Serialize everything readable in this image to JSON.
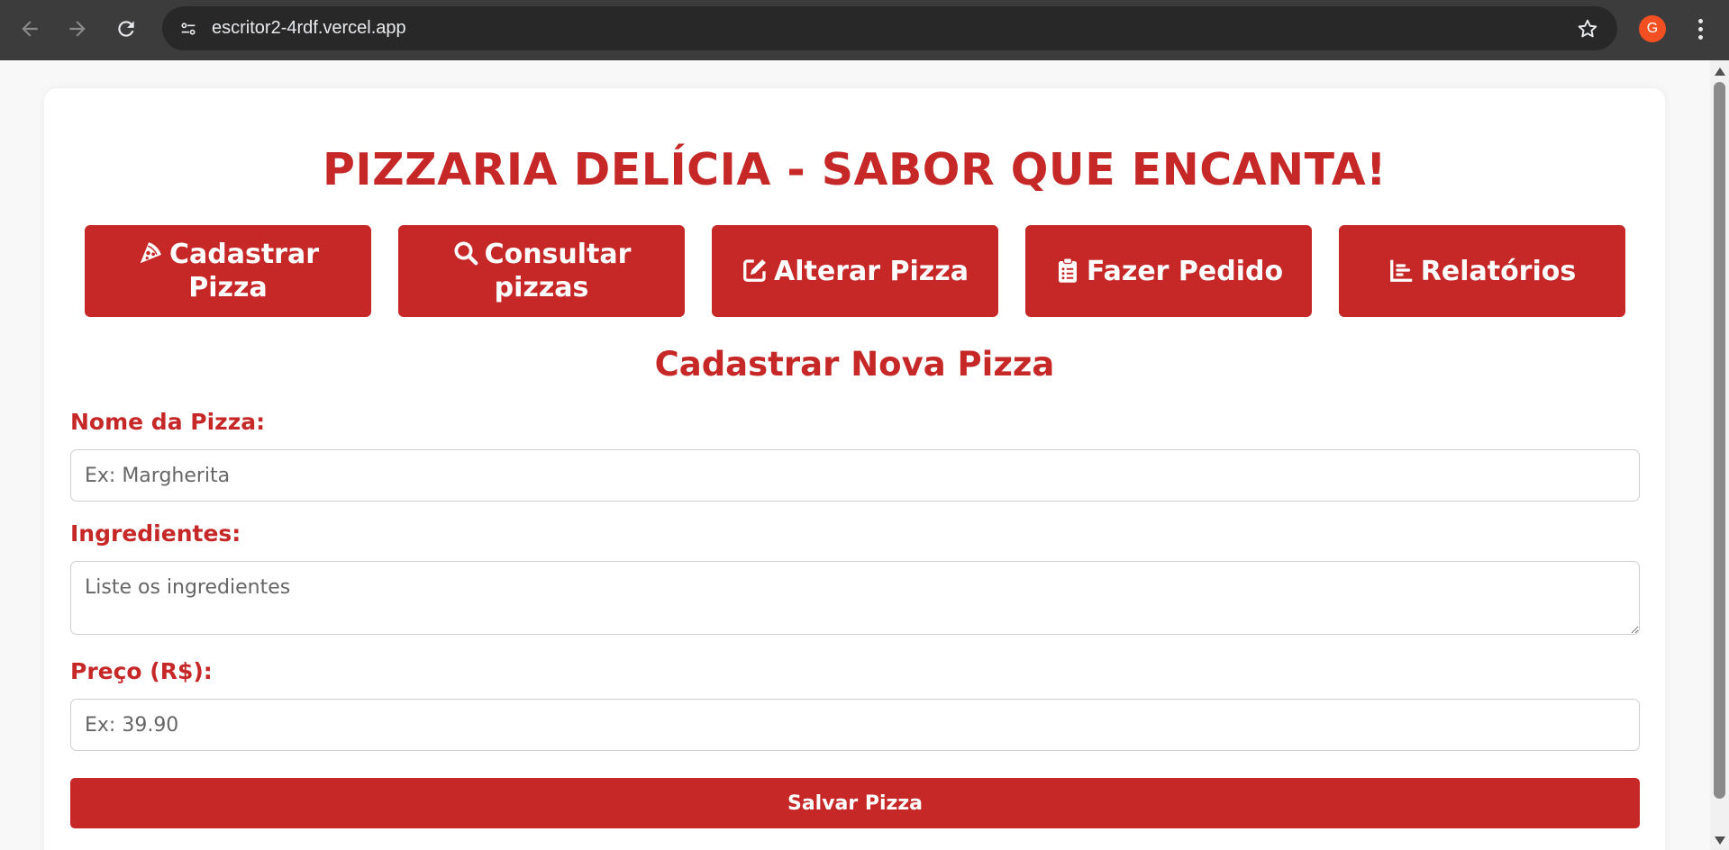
{
  "browser": {
    "url": "escritor2-4rdf.vercel.app",
    "avatar_letter": "G",
    "avatar_color": "#f25022"
  },
  "page": {
    "title": "PIZZARIA DELÍCIA - SABOR QUE ENCANTA!",
    "accent_color": "#c62828",
    "nav_buttons": [
      {
        "icon": "pizza-slice-icon",
        "label": "Cadastrar Pizza"
      },
      {
        "icon": "search-icon",
        "label": "Consultar pizzas"
      },
      {
        "icon": "edit-icon",
        "label": "Alterar Pizza"
      },
      {
        "icon": "clipboard-list-icon",
        "label": "Fazer Pedido"
      },
      {
        "icon": "chart-icon",
        "label": "Relatórios"
      }
    ],
    "form": {
      "heading": "Cadastrar Nova Pizza",
      "name_label": "Nome da Pizza:",
      "name_placeholder": "Ex: Margherita",
      "ingredients_label": "Ingredientes:",
      "ingredients_placeholder": "Liste os ingredientes",
      "price_label": "Preço (R$):",
      "price_placeholder": "Ex: 39.90",
      "submit_label": "Salvar Pizza"
    }
  }
}
